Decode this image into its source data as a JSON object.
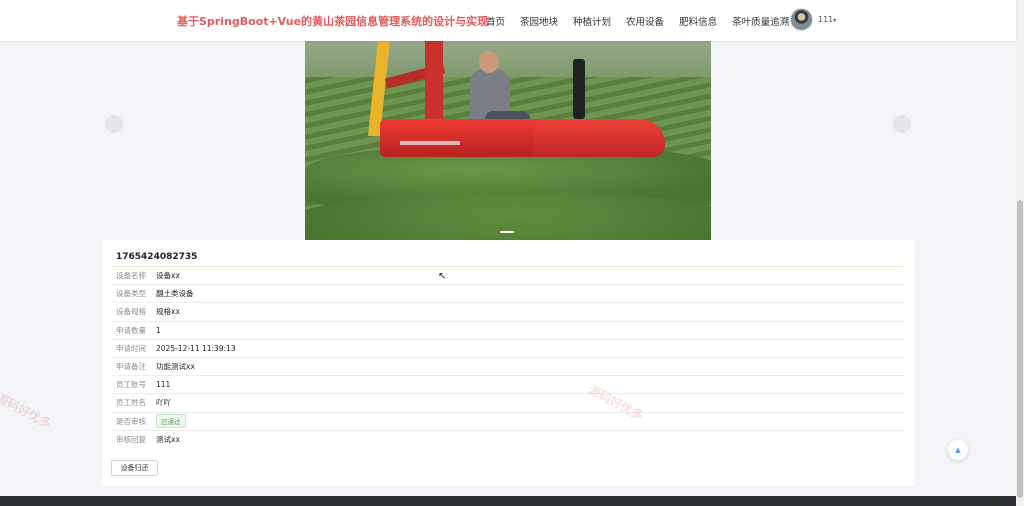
{
  "header": {
    "brand": "基于SpringBoot+Vue的黄山茶园信息管理系统的设计与实现",
    "nav": [
      "首页",
      "茶园地块",
      "种植计划",
      "农用设备",
      "肥料信息",
      "茶叶质量追溯"
    ],
    "username": "111",
    "caret": "▾"
  },
  "detail": {
    "title": "1765424082735",
    "fields": [
      {
        "label": "设备名称",
        "value": "设备xx"
      },
      {
        "label": "设备类型",
        "value": "翻土类设备"
      },
      {
        "label": "设备规格",
        "value": "规格xx"
      },
      {
        "label": "申请数量",
        "value": "1"
      },
      {
        "label": "申请时间",
        "value": "2025-12-11 11:39:13"
      },
      {
        "label": "申请备注",
        "value": "功能测试xx"
      },
      {
        "label": "员工账号",
        "value": "111"
      },
      {
        "label": "员工姓名",
        "value": "吖吖"
      },
      {
        "label": "是否审核",
        "value": "已通过"
      },
      {
        "label": "审核回复",
        "value": "测试xx"
      }
    ],
    "return_button": "设备归还"
  },
  "watermark": "源码好优多",
  "colors": {
    "brand": "#e45b5b",
    "approved": "#52a85e",
    "accent": "#409eff"
  },
  "icons": {
    "back_to_top": "chevron-up-icon"
  }
}
